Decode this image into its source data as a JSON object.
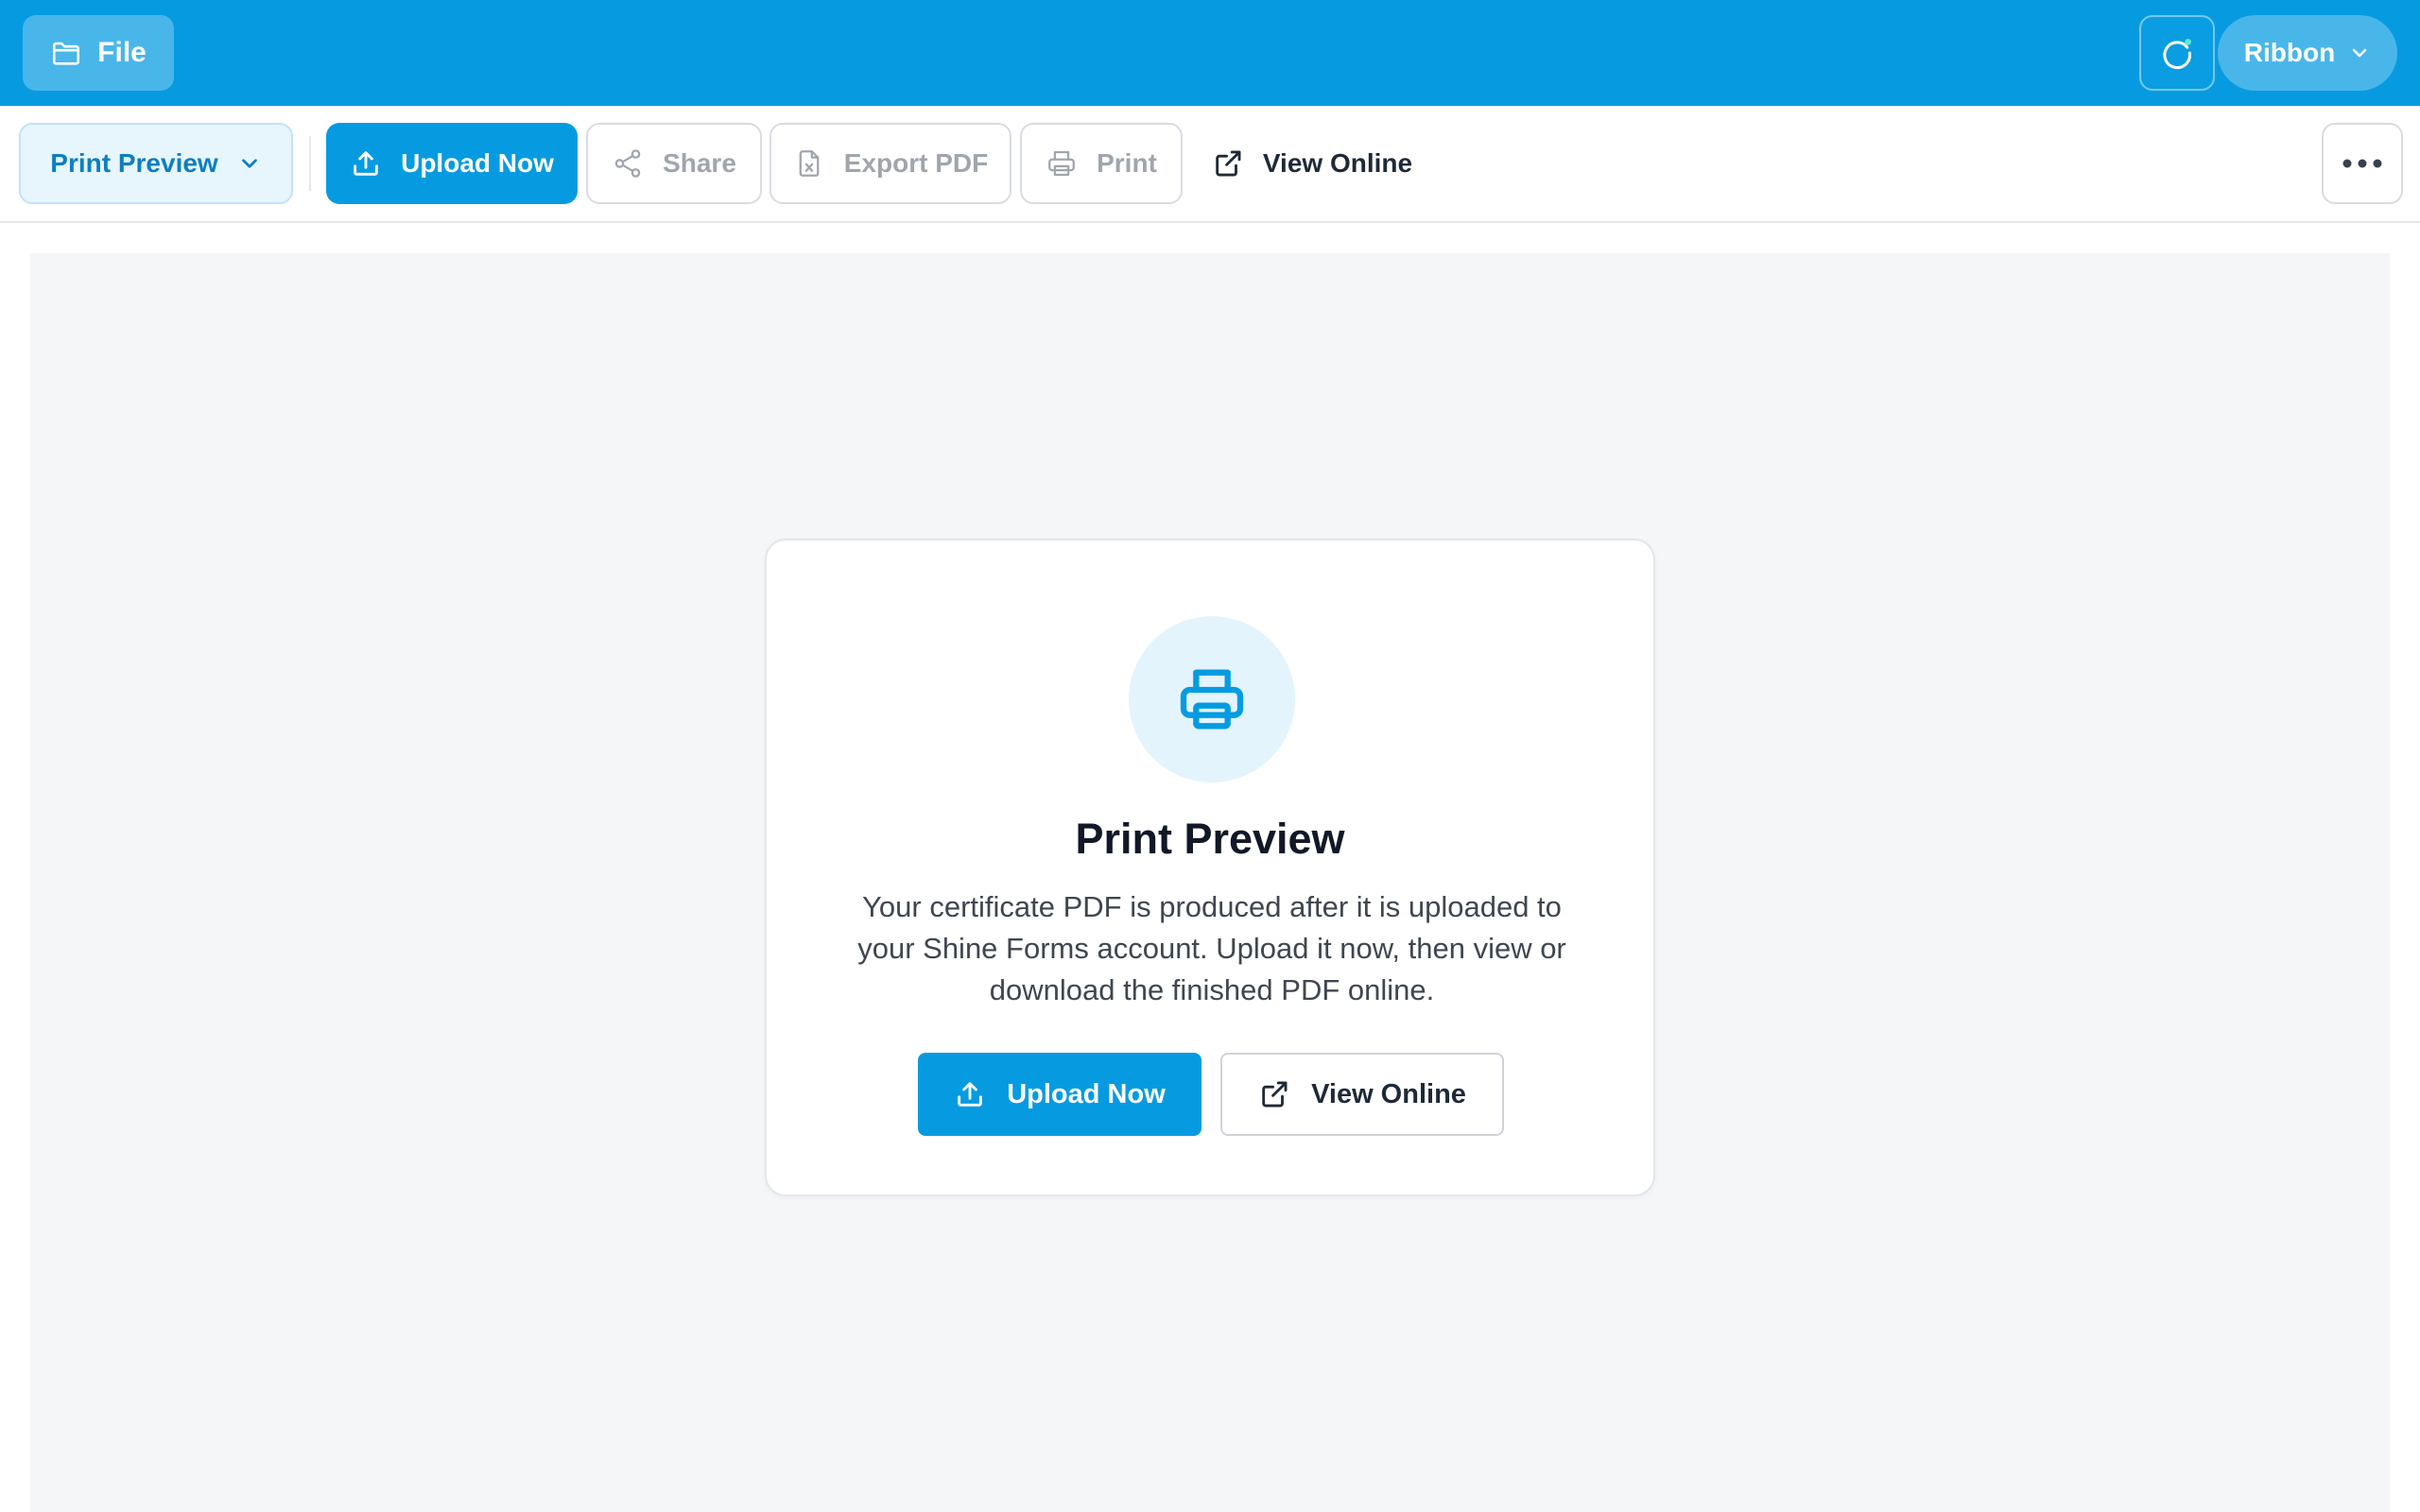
{
  "topbar": {
    "file_label": "File",
    "ribbon_label": "Ribbon",
    "accent_color": "#069be1"
  },
  "toolbar": {
    "view_mode": "Print Preview",
    "upload_label": "Upload Now",
    "share_label": "Share",
    "export_label": "Export PDF",
    "print_label": "Print",
    "view_online_label": "View Online"
  },
  "card": {
    "title": "Print Preview",
    "description": "Your certificate PDF is produced after it is uploaded to your Shine Forms account. Upload it now, then view or download the finished PDF online.",
    "upload_label": "Upload Now",
    "view_online_label": "View Online"
  },
  "icons": {
    "file": "folder-icon",
    "refresh": "refresh-icon",
    "dropdown": "chevron-down-icon",
    "upload": "upload-icon",
    "share": "share-icon",
    "export": "file-x-icon",
    "print": "printer-icon",
    "external": "external-link-icon",
    "more": "more-horizontal-icon"
  }
}
